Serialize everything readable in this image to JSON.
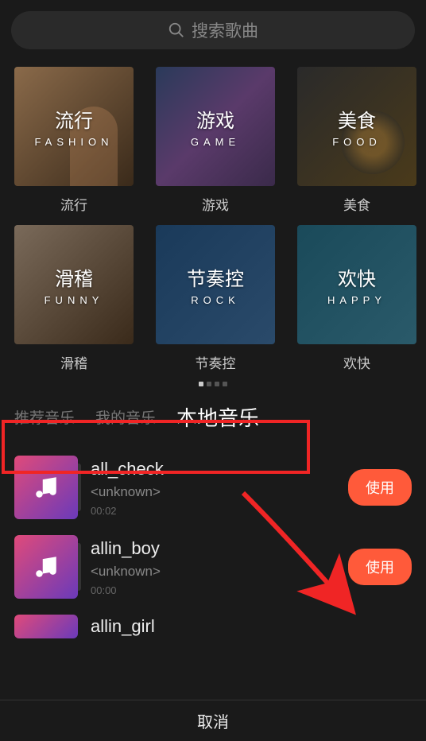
{
  "search": {
    "placeholder": "搜索歌曲"
  },
  "categories": [
    {
      "title_cn": "流行",
      "title_en": "FASHION",
      "label": "流行",
      "tile_class": "tile-fashion"
    },
    {
      "title_cn": "游戏",
      "title_en": "GAME",
      "label": "游戏",
      "tile_class": "tile-game"
    },
    {
      "title_cn": "美食",
      "title_en": "FOOD",
      "label": "美食",
      "tile_class": "tile-food"
    },
    {
      "title_cn": "滑稽",
      "title_en": "FUNNY",
      "label": "滑稽",
      "tile_class": "tile-funny"
    },
    {
      "title_cn": "节奏控",
      "title_en": "ROCK",
      "label": "节奏控",
      "tile_class": "tile-rock"
    },
    {
      "title_cn": "欢快",
      "title_en": "HAPPY",
      "label": "欢快",
      "tile_class": "tile-happy"
    }
  ],
  "tabs": {
    "recommended": "推荐音乐",
    "my_music": "我的音乐",
    "local_music": "本地音乐"
  },
  "songs": [
    {
      "title": "all_check",
      "artist": "<unknown>",
      "duration": "00:02",
      "use_label": "使用"
    },
    {
      "title": "allin_boy",
      "artist": "<unknown>",
      "duration": "00:00",
      "use_label": "使用"
    },
    {
      "title": "allin_girl",
      "artist": "",
      "duration": "",
      "use_label": ""
    }
  ],
  "cancel": "取消"
}
